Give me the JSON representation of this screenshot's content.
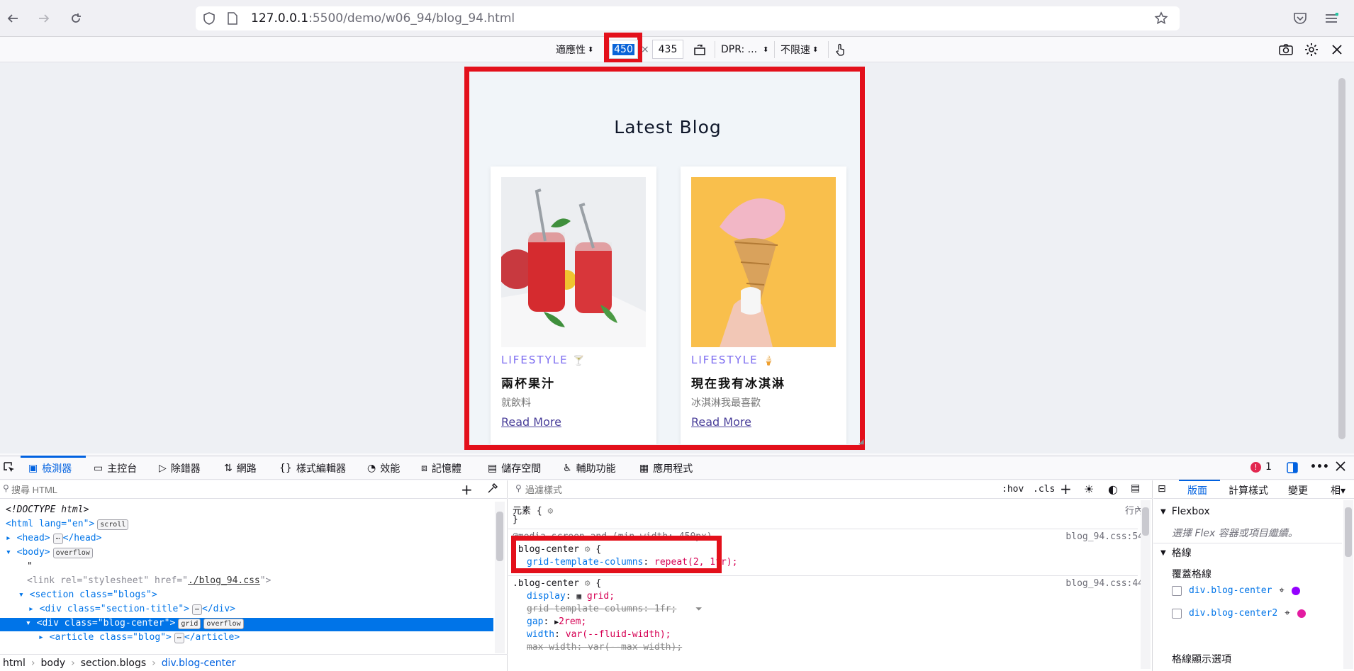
{
  "browser": {
    "url_host": "127.0.0.1",
    "url_rest": ":5500/demo/w06_94/blog_94.html"
  },
  "rdm": {
    "device": "適應性",
    "width": "450",
    "times": "×",
    "height": "435",
    "dpr": "DPR: ...",
    "throttle": "不限速"
  },
  "page": {
    "section_title": "Latest Blog",
    "cards": [
      {
        "tag": "LIFESTYLE",
        "title": "兩杯果汁",
        "sub": "就飲料",
        "more": "Read More"
      },
      {
        "tag": "LIFESTYLE",
        "title": "現在我有冰淇淋",
        "sub": "冰淇淋我最喜歡",
        "more": "Read More"
      }
    ]
  },
  "devtools": {
    "tabs": [
      "檢測器",
      "主控台",
      "除錯器",
      "網路",
      "樣式編輯器",
      "效能",
      "記憶體",
      "儲存空間",
      "輔助功能",
      "應用程式"
    ],
    "error_count": "1",
    "search_placeholder": "搜尋 HTML",
    "filter_placeholder": "過濾樣式",
    "hov": ":hov",
    "cls": ".cls",
    "html_tree": {
      "doctype": "<!DOCTYPE html>",
      "html_open": "<html lang=\"en\">",
      "scroll_badge": "scroll",
      "head": "<head>",
      "head_close": "</head>",
      "body": "<body>",
      "overflow_badge": "overflow",
      "text_node": "\"",
      "link_pre": "<link rel=\"stylesheet\" href=\"",
      "link_href": "./blog_94.css",
      "link_post": "\">",
      "section": "<section class=\"blogs\">",
      "div_title": "<div class=\"section-title\">",
      "div_close": "</div>",
      "div_center": "<div class=\"blog-center\">",
      "grid_badge": "grid",
      "article": "<article class=\"blog\">",
      "article_close": "</article>"
    },
    "breadcrumb": [
      "html",
      "body",
      "section.blogs",
      "div.blog-center"
    ],
    "rules": {
      "element": "元素 {",
      "element_close": "}",
      "inline": "行內",
      "media": "@media screen and (min-width: 450px)",
      "media_src": "blog_94.css:54",
      "sel1": ".blog-center",
      "gtc_prop": "grid-template-columns",
      "gtc_val": "repeat(2, 1fr);",
      "sel2": ".blog-center",
      "src2": "blog_94.css:44",
      "display_prop": "display",
      "display_val": "grid;",
      "gtc2": "grid-template-columns: 1fr;",
      "gap_prop": "gap",
      "gap_val": "2rem;",
      "width_prop": "width",
      "width_val": "var(--fluid-width);",
      "maxw": "max-width: var(--max-width);"
    },
    "right_tabs": [
      "版面",
      "計算樣式",
      "變更",
      "相"
    ],
    "flexbox_h": "Flexbox",
    "flexbox_msg": "選擇 Flex 容器或項目繼續。",
    "grid_h": "格線",
    "overlay_h": "覆蓋格線",
    "grid_items": [
      "div.blog-center",
      "div.blog-center2"
    ],
    "grid_display_h": "格線顯示選項",
    "grid_colors": [
      "#9400ff",
      "#e31ba1"
    ]
  }
}
